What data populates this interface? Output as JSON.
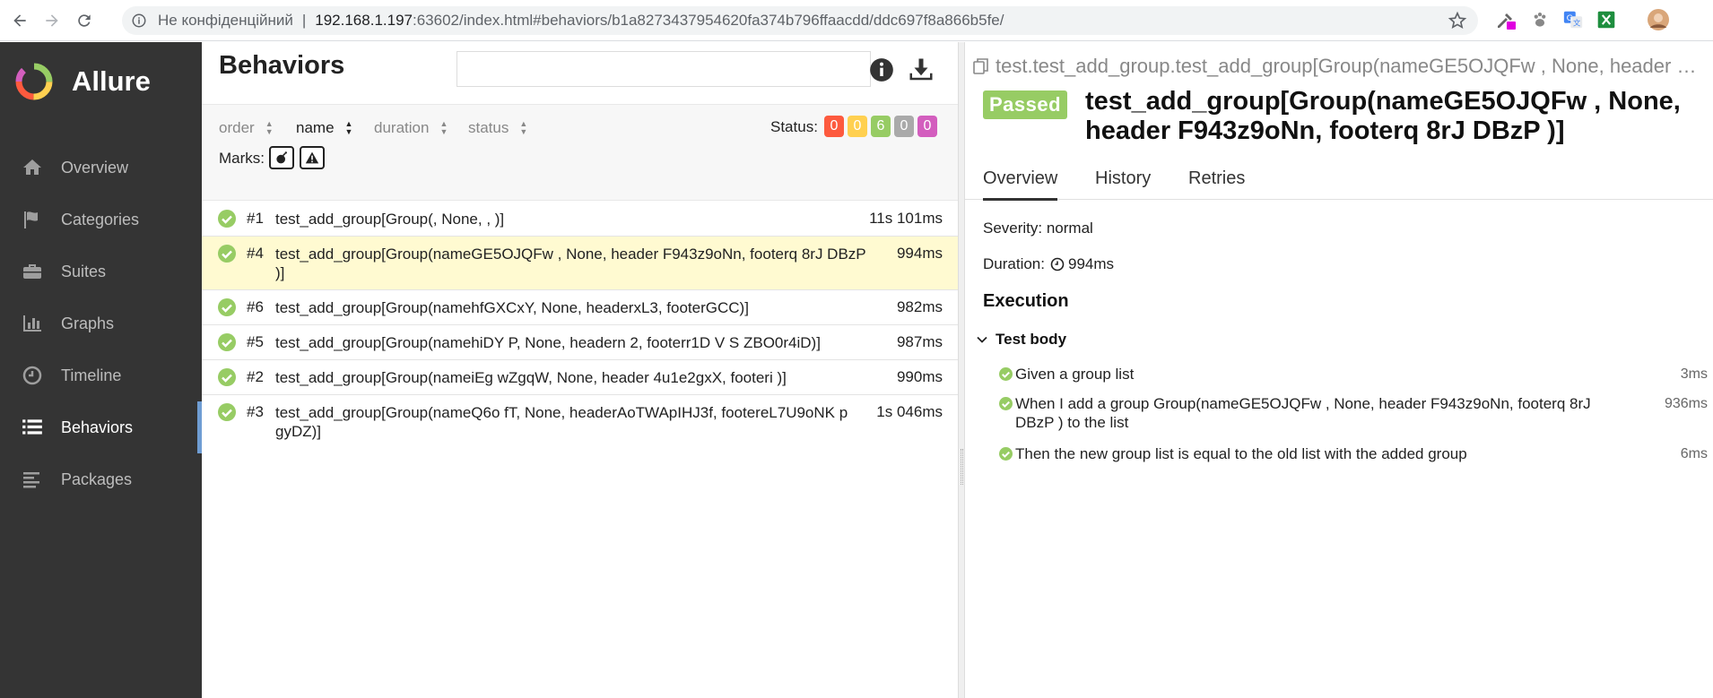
{
  "browser": {
    "not_secure": "Не конфіденційний",
    "url_host": "192.168.1.197",
    "url_rest": ":63602/index.html#behaviors/b1a8273437954620fa374b796ffaacdd/ddc697f8a866b5fe/"
  },
  "sidebar": {
    "brand": "Allure",
    "items": [
      {
        "label": "Overview",
        "icon": "home-icon"
      },
      {
        "label": "Categories",
        "icon": "flag-icon"
      },
      {
        "label": "Suites",
        "icon": "briefcase-icon"
      },
      {
        "label": "Graphs",
        "icon": "bar-chart-icon"
      },
      {
        "label": "Timeline",
        "icon": "clock-icon"
      },
      {
        "label": "Behaviors",
        "icon": "list-icon",
        "active": true
      },
      {
        "label": "Packages",
        "icon": "packages-icon"
      }
    ]
  },
  "behaviors": {
    "title": "Behaviors",
    "search_value": "",
    "sort": {
      "order": "order",
      "name": "name",
      "duration": "duration",
      "status": "status"
    },
    "status_label": "Status:",
    "status_counts": [
      {
        "value": "0",
        "color": "#fd5a3e"
      },
      {
        "value": "0",
        "color": "#ffd050"
      },
      {
        "value": "6",
        "color": "#97cc64"
      },
      {
        "value": "0",
        "color": "#aaaaaa"
      },
      {
        "value": "0",
        "color": "#d35ebe"
      }
    ],
    "marks_label": "Marks:",
    "rows": [
      {
        "num": "#1",
        "name": "test_add_group[Group(, None, , )]",
        "duration": "11s 101ms"
      },
      {
        "num": "#4",
        "name": "test_add_group[Group(nameGE5OJQFw , None, header F943z9oNn, footerq 8rJ DBzP )]",
        "duration": "994ms",
        "selected": true
      },
      {
        "num": "#6",
        "name": "test_add_group[Group(namehfGXCxY, None, headerxL3, footerGCC)]",
        "duration": "982ms"
      },
      {
        "num": "#5",
        "name": "test_add_group[Group(namehiDY P, None, headern 2, footerr1D V S ZBO0r4iD)]",
        "duration": "987ms"
      },
      {
        "num": "#2",
        "name": "test_add_group[Group(nameiEg wZgqW, None, header 4u1e2gxX, footeri )]",
        "duration": "990ms"
      },
      {
        "num": "#3",
        "name": "test_add_group[Group(nameQ6o fT, None, headerAoTWApIHJ3f, footereL7U9oNK p gyDZ)]",
        "duration": "1s 046ms"
      }
    ]
  },
  "testcase": {
    "path": "test.test_add_group.test_add_group[Group(nameGE5OJQFw , None, header …",
    "status": "Passed",
    "title": "test_add_group[Group(nameGE5OJQFw , None, header F943z9oNn, footerq 8rJ DBzP )]",
    "tabs": [
      "Overview",
      "History",
      "Retries"
    ],
    "severity": "Severity: normal",
    "duration_label": "Duration:",
    "duration_value": "994ms",
    "execution_title": "Execution",
    "body_title": "Test body",
    "steps": [
      {
        "text": "Given a group list",
        "duration": "3ms"
      },
      {
        "text": "When I add a group Group(nameGE5OJQFw , None, header F943z9oNn, footerq 8rJ DBzP ) to the list",
        "duration": "936ms"
      },
      {
        "text": "Then the new group list is equal to the old list with the added group",
        "duration": "6ms"
      }
    ]
  }
}
